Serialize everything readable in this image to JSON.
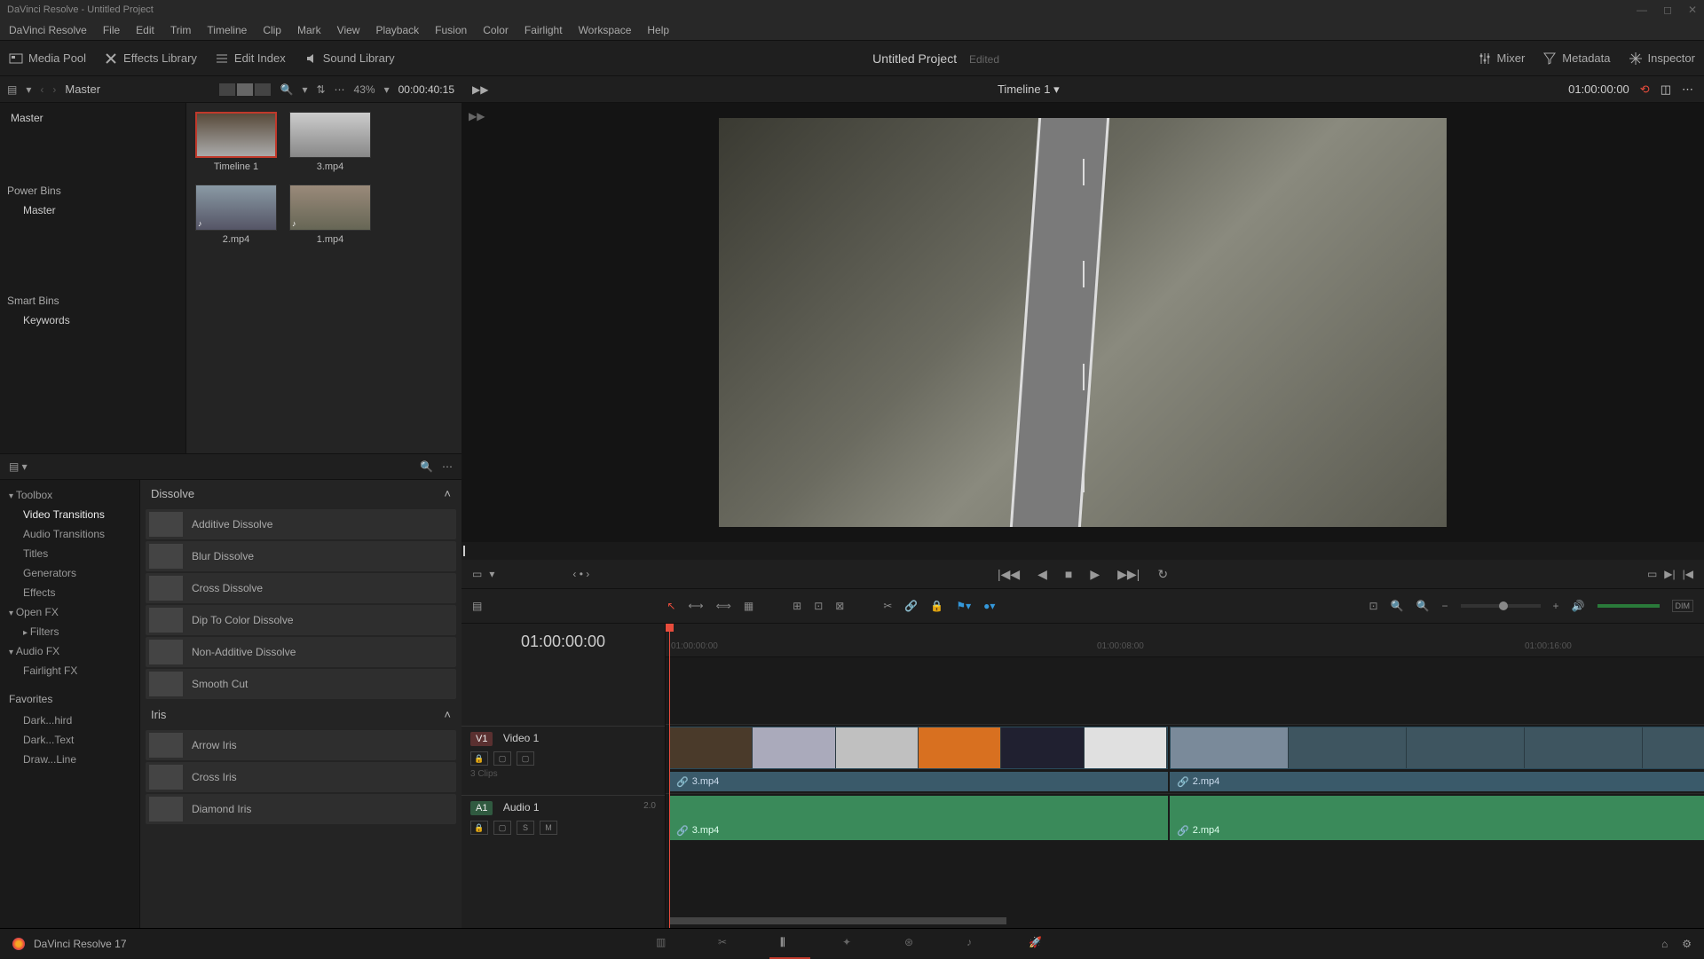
{
  "app": {
    "titlebar": "DaVinci Resolve - Untitled Project",
    "version": "DaVinci Resolve 17"
  },
  "menu": [
    "DaVinci Resolve",
    "File",
    "Edit",
    "Trim",
    "Timeline",
    "Clip",
    "Mark",
    "View",
    "Playback",
    "Fusion",
    "Color",
    "Fairlight",
    "Workspace",
    "Help"
  ],
  "topbar": {
    "left": {
      "media_pool": "Media Pool",
      "effects_library": "Effects Library",
      "edit_index": "Edit Index",
      "sound_library": "Sound Library"
    },
    "project": "Untitled Project",
    "status": "Edited",
    "right": {
      "mixer": "Mixer",
      "metadata": "Metadata",
      "inspector": "Inspector"
    }
  },
  "media": {
    "breadcrumb": "Master",
    "zoom": "43%",
    "source_tc": "00:00:40:15",
    "bins": {
      "root": "Master",
      "power": "Power Bins",
      "power_item": "Master",
      "smart": "Smart Bins",
      "smart_item": "Keywords"
    },
    "clips": [
      {
        "name": "Timeline 1",
        "selected": true
      },
      {
        "name": "3.mp4"
      },
      {
        "name": "2.mp4"
      },
      {
        "name": "1.mp4"
      }
    ]
  },
  "fx": {
    "tree": {
      "toolbox": "Toolbox",
      "video_transitions": "Video Transitions",
      "audio_transitions": "Audio Transitions",
      "titles": "Titles",
      "generators": "Generators",
      "effects": "Effects",
      "openfx": "Open FX",
      "filters": "Filters",
      "audiofx": "Audio FX",
      "fairlightfx": "Fairlight FX",
      "favorites": "Favorites",
      "fav1": "Dark...hird",
      "fav2": "Dark...Text",
      "fav3": "Draw...Line"
    },
    "groups": [
      {
        "name": "Dissolve",
        "items": [
          "Additive Dissolve",
          "Blur Dissolve",
          "Cross Dissolve",
          "Dip To Color Dissolve",
          "Non-Additive Dissolve",
          "Smooth Cut"
        ]
      },
      {
        "name": "Iris",
        "items": [
          "Arrow Iris",
          "Cross Iris",
          "Diamond Iris"
        ]
      }
    ]
  },
  "viewer": {
    "timeline_name": "Timeline 1",
    "record_tc": "01:00:00:00"
  },
  "timeline": {
    "tc": "01:00:00:00",
    "ruler": [
      "01:00:00:00",
      "01:00:08:00",
      "01:00:16:00"
    ],
    "video_track": {
      "badge": "V1",
      "name": "Video 1",
      "clip_count": "3 Clips"
    },
    "audio_track": {
      "badge": "A1",
      "name": "Audio 1",
      "format": "2.0"
    },
    "clips": {
      "v1a": {
        "src": "3.mp4"
      },
      "v1b": {
        "src": "2.mp4"
      },
      "a1a": {
        "src": "3.mp4"
      },
      "a1b": {
        "src": "2.mp4"
      }
    },
    "track_btns": {
      "lock": "🔒",
      "auto": "▢",
      "eye": "▢",
      "solo": "S",
      "mute": "M"
    }
  }
}
